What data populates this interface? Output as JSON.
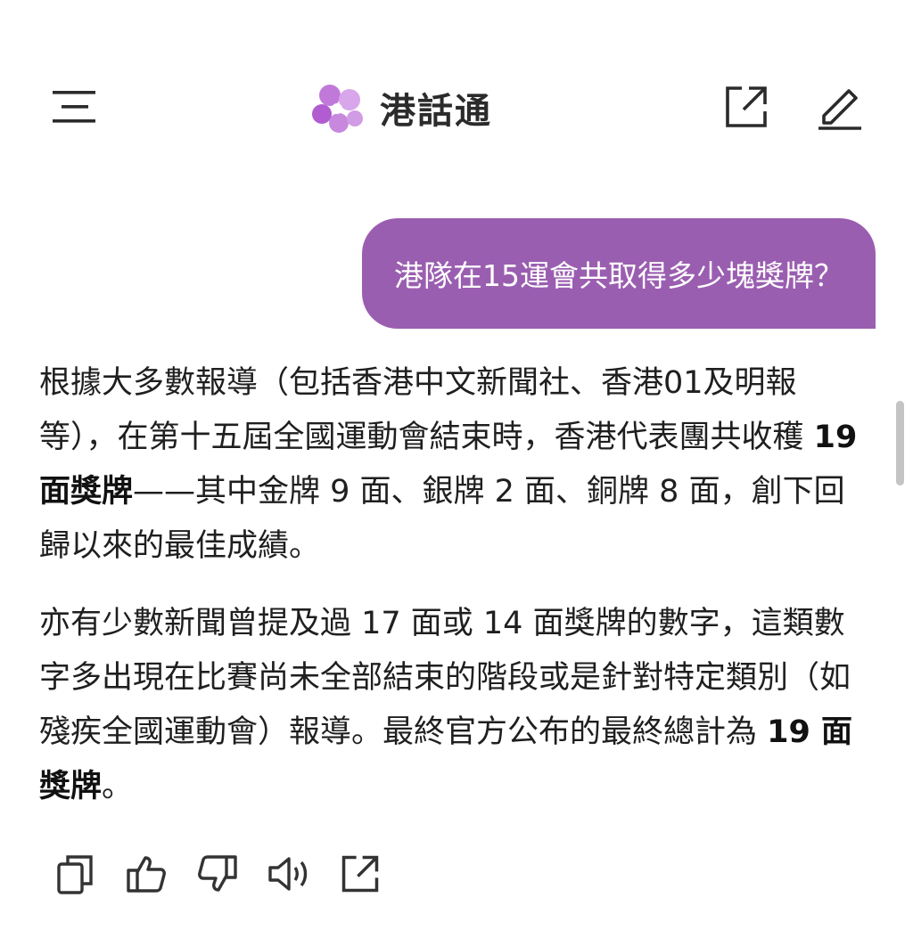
{
  "header": {
    "app_name": "港話通",
    "logo_color": "#c179d9",
    "menu_icon": "menu-icon",
    "share_icon": "external-link-icon",
    "edit_icon": "pencil-icon"
  },
  "conversation": {
    "user_message": "港隊在15運會共取得多少塊獎牌？",
    "user_bubble_color": "#9a5eb0",
    "answer": {
      "p1": {
        "a": "根據大多數報導（包括香港中文新聞社、香港01及明報等），在第十五屆全國運動會結束時，香港代表團共收穫 ",
        "b": "19 面獎牌",
        "c": "——其中金牌 9 面、銀牌 2 面、銅牌 8 面，創下回歸以來的最佳成績。"
      },
      "p2": {
        "a": "亦有少數新聞曾提及過 17 面或 14 面獎牌的數字，這類數字多出現在比賽尚未全部結束的階段或是針對特定類別（如殘疾全國運動會）報導。最終官方公布的最終總計為 ",
        "b": "19 面獎牌",
        "c": "。"
      }
    }
  },
  "actions": [
    "copy-icon",
    "thumbs-up-icon",
    "thumbs-down-icon",
    "speaker-icon",
    "external-link-icon"
  ]
}
